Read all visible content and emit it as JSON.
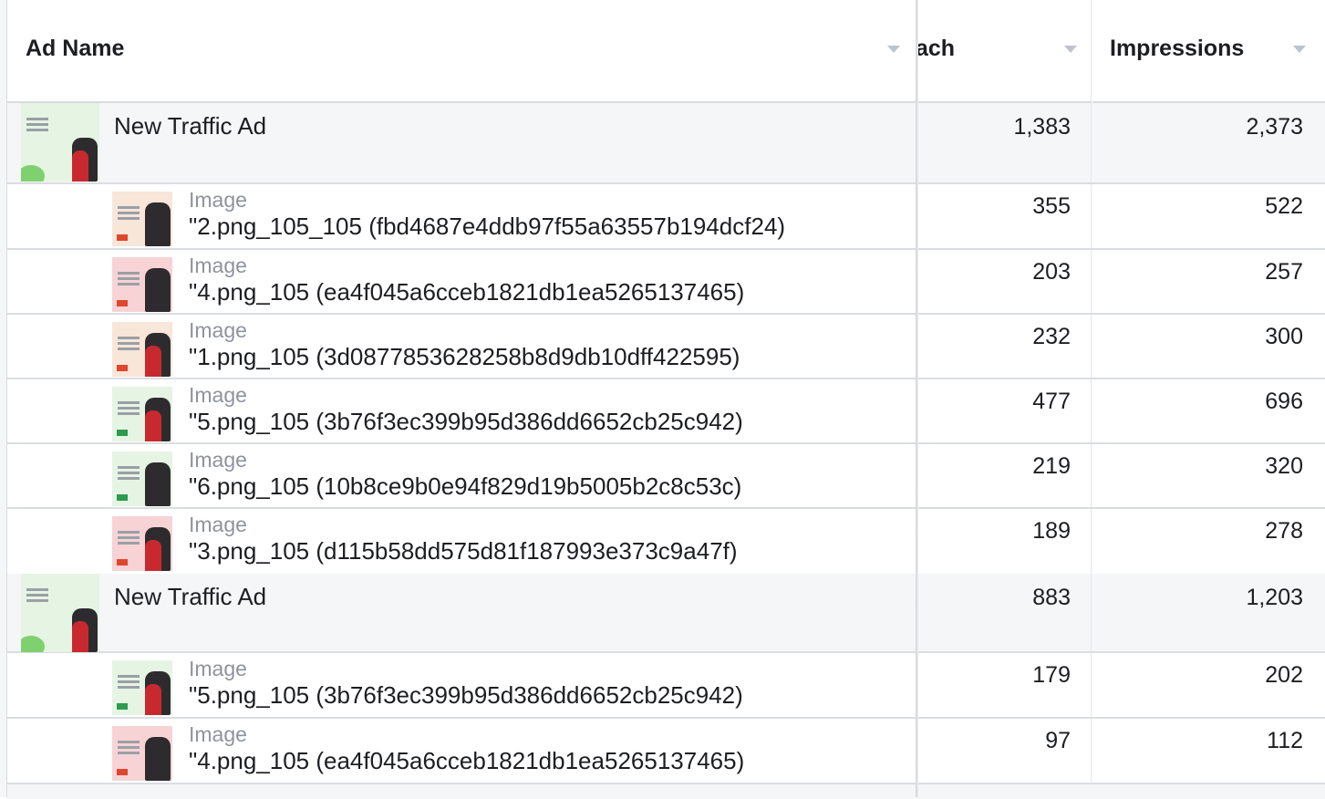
{
  "columns": {
    "ad_name": "Ad Name",
    "reach": "ach",
    "impressions": "Impressions"
  },
  "rows": [
    {
      "kind": "parent",
      "title": "New Traffic Ad",
      "thumb": "green",
      "reach": "1,383",
      "impressions": "2,373"
    },
    {
      "kind": "child",
      "type": "Image",
      "name": "\"2.png_105_105 (fbd4687e4ddb97f55a63557b194dcf24)",
      "thumb": "peach",
      "reach": "355",
      "impressions": "522"
    },
    {
      "kind": "child",
      "type": "Image",
      "name": "\"4.png_105 (ea4f045a6cceb1821db1ea5265137465)",
      "thumb": "pink",
      "reach": "203",
      "impressions": "257"
    },
    {
      "kind": "child",
      "type": "Image",
      "name": "\"1.png_105 (3d0877853628258b8d9db10dff422595)",
      "thumb": "peach",
      "reach": "232",
      "impressions": "300"
    },
    {
      "kind": "child",
      "type": "Image",
      "name": "\"5.png_105 (3b76f3ec399b95d386dd6652cb25c942)",
      "thumb": "green",
      "reach": "477",
      "impressions": "696"
    },
    {
      "kind": "child",
      "type": "Image",
      "name": "\"6.png_105 (10b8ce9b0e94f829d19b5005b2c8c53c)",
      "thumb": "green",
      "reach": "219",
      "impressions": "320"
    },
    {
      "kind": "child",
      "type": "Image",
      "name": "\"3.png_105 (d115b58dd575d81f187993e373c9a47f)",
      "thumb": "pink",
      "reach": "189",
      "impressions": "278"
    },
    {
      "kind": "parent",
      "title": "New Traffic Ad",
      "thumb": "green",
      "reach": "883",
      "impressions": "1,203"
    },
    {
      "kind": "child",
      "type": "Image",
      "name": "\"5.png_105 (3b76f3ec399b95d386dd6652cb25c942)",
      "thumb": "green",
      "reach": "179",
      "impressions": "202"
    },
    {
      "kind": "child",
      "type": "Image",
      "name": "\"4.png_105 (ea4f045a6cceb1821db1ea5265137465)",
      "thumb": "pink",
      "reach": "97",
      "impressions": "112"
    }
  ]
}
